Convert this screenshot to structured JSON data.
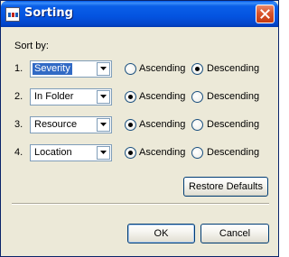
{
  "window": {
    "title": "Sorting",
    "app_icon": "app-icon",
    "close_icon": "close-icon"
  },
  "sort_by_label": "Sort by:",
  "rows": [
    {
      "number": "1.",
      "field": "Severity",
      "focused": true,
      "ascending_label": "Ascending",
      "descending_label": "Descending",
      "order": "descending"
    },
    {
      "number": "2.",
      "field": "In Folder",
      "focused": false,
      "ascending_label": "Ascending",
      "descending_label": "Descending",
      "order": "ascending"
    },
    {
      "number": "3.",
      "field": "Resource",
      "focused": false,
      "ascending_label": "Ascending",
      "descending_label": "Descending",
      "order": "ascending"
    },
    {
      "number": "4.",
      "field": "Location",
      "focused": false,
      "ascending_label": "Ascending",
      "descending_label": "Descending",
      "order": "ascending"
    }
  ],
  "buttons": {
    "restore_defaults": "Restore Defaults",
    "ok": "OK",
    "cancel": "Cancel"
  },
  "colors": {
    "titlebar": "#0453e0",
    "dialog_bg": "#ece9d8",
    "selection": "#316ac5",
    "radio_check": "#21a121",
    "close_button": "#d9542c"
  }
}
